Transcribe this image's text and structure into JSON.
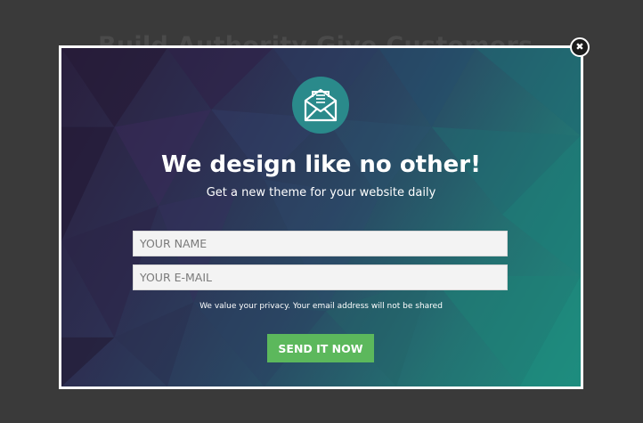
{
  "background": {
    "heading": "Build Authority Give Customers"
  },
  "popup": {
    "close_label": "✖",
    "headline": "We design like no other!",
    "subline": "Get a new theme for your website daily",
    "name_placeholder": "YOUR NAME",
    "email_placeholder": "YOUR E-MAIL",
    "privacy_note": "We value your privacy. Your email address will not be shared",
    "submit_label": "SEND IT NOW"
  },
  "colors": {
    "accent_green": "#5cb85c",
    "icon_circle": "#2a8a8b",
    "page_background": "#3a3a3a"
  },
  "icons": {
    "envelope": "envelope-letter-icon",
    "close": "close-icon"
  }
}
